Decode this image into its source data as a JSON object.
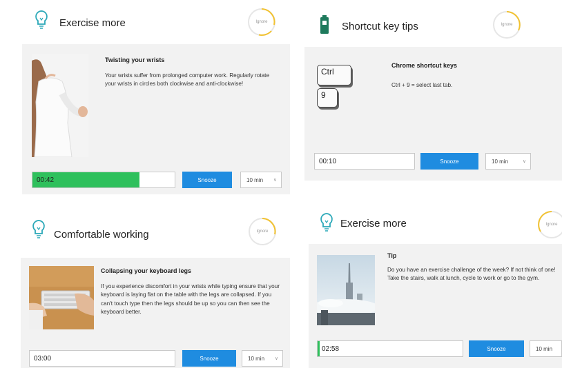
{
  "panels": [
    {
      "title": "Exercise more",
      "ignore": "Ignore",
      "heading": "Twisting your wrists",
      "text": "Your wrists suffer from prolonged computer work. Regularly rotate your wrists in circles both clockwise and anti-clockwise!",
      "timer": "00:42",
      "progress": 0.75,
      "snooze": "Snooze",
      "duration": "10 min",
      "icon": "lightbulb-icon"
    },
    {
      "title": "Shortcut key tips",
      "ignore": "Ignore",
      "heading": "Chrome shortcut keys",
      "text": "Ctrl + 9 = select last tab.",
      "key1": "Ctrl",
      "key2": "9",
      "timer": "00:10",
      "snooze": "Snooze",
      "duration": "10 min",
      "icon": "battery-icon"
    },
    {
      "title": "Comfortable working",
      "ignore": "Ignore",
      "heading": "Collapsing your keyboard legs",
      "text": "If you experience discomfort in your wrists while typing ensure that your keyboard is laying flat on the table with the legs are collapsed. If you can't touch type then the legs should be up so you can then see the keyboard better.",
      "timer": "03:00",
      "snooze": "Snooze",
      "duration": "10 min",
      "icon": "lightbulb-icon"
    },
    {
      "title": "Exercise more",
      "ignore": "Ignore",
      "heading": "Tip",
      "text": "Do you have an exercise challenge of the week? If not think of one! Take the stairs, walk at lunch, cycle to work or go to the gym.",
      "timer": "02:58",
      "snooze": "Snooze",
      "duration": "10 min",
      "icon": "lightbulb-icon"
    }
  ],
  "colors": {
    "accent": "#1f8ce0",
    "progress": "#2ec05c",
    "bulb": "#2aa8b8",
    "ring": "#f2c230",
    "battery": "#1e7a5c"
  }
}
